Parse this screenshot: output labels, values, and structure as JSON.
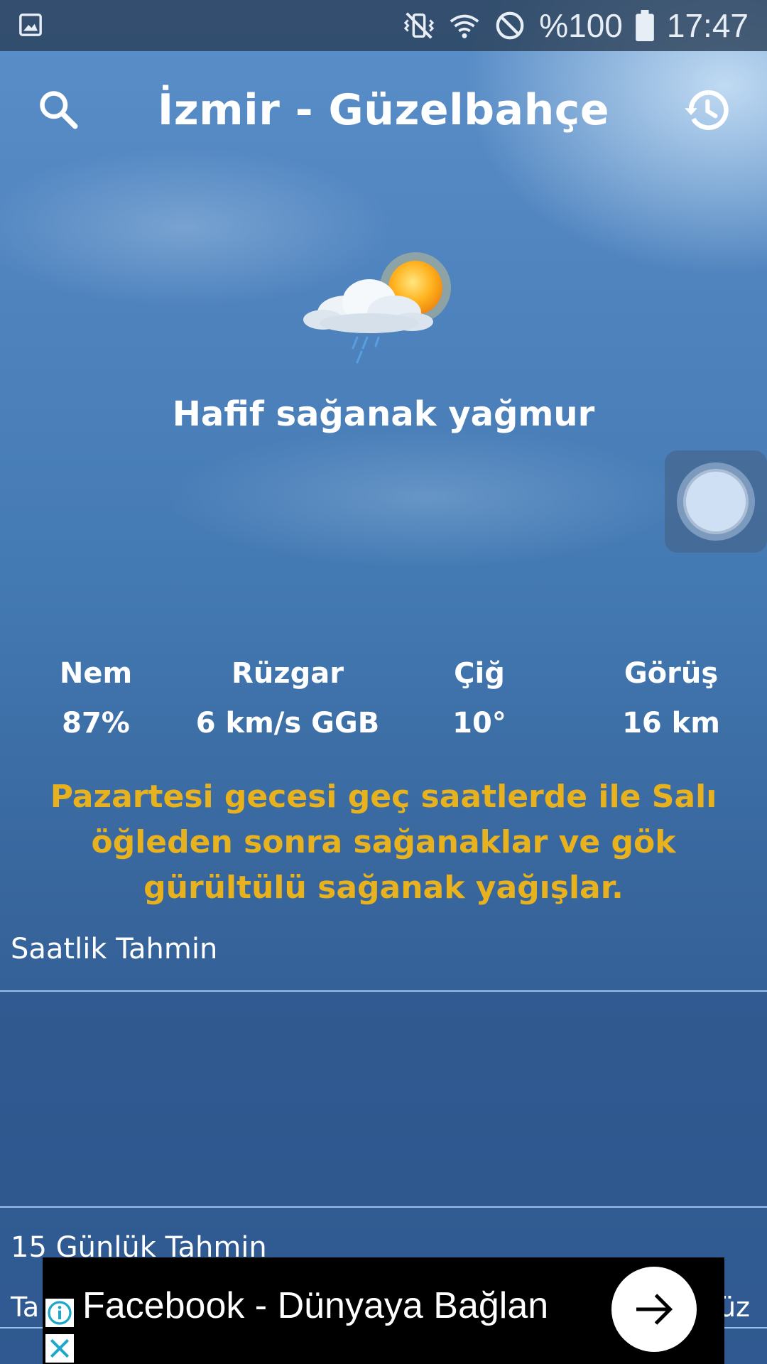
{
  "status_bar": {
    "battery": "%100",
    "time": "17:47",
    "icons": [
      "gallery-icon",
      "vibrate-mute-icon",
      "wifi-icon",
      "do-not-disturb-icon",
      "battery-icon"
    ]
  },
  "header": {
    "location": "İzmir - Güzelbahçe",
    "icons": [
      "search-icon",
      "history-icon"
    ]
  },
  "current": {
    "icon": "partly-cloudy-rain-icon",
    "condition": "Hafif sağanak yağmur"
  },
  "stats": [
    {
      "label": "Nem",
      "value": "87%"
    },
    {
      "label": "Rüzgar",
      "value": "6 km/s GGB"
    },
    {
      "label": "Çiğ",
      "value": "10°"
    },
    {
      "label": "Görüş",
      "value": "16 km"
    }
  ],
  "forecast_text": "Pazartesi gecesi geç saatlerde ile Salı öğleden sonra sağanaklar ve gök gürültülü sağanak yağışlar.",
  "sections": {
    "hourly_title": "Saatlik Tahmin",
    "daily_title": "15 Günlük Tahmin",
    "partial_left": "Ta",
    "partial_right": "üz"
  },
  "ad": {
    "text": "Facebook - Dünyaya Bağlan"
  },
  "colors": {
    "forecast_text": "#e8b21e",
    "divider": "#9cc0ea",
    "ad_background": "#000000"
  }
}
